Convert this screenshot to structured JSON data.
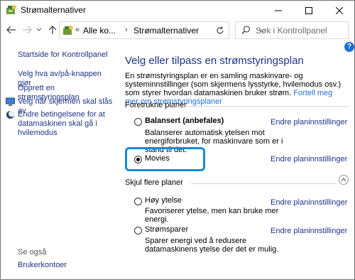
{
  "window": {
    "title": "Strømalternativer"
  },
  "address": {
    "overflow": "«",
    "crumbs": [
      "Alle ko...",
      "Strømalternativer"
    ],
    "separator": "›"
  },
  "search": {
    "placeholder": "Søk i Kontrollpanel"
  },
  "sidebar": {
    "home": "Startside for Kontrollpanel",
    "links": [
      "Velg hva av/på-knappen gjør",
      "Opprett en strømstyringsplan",
      "Velg når skjermen skal slås av",
      "Endre betingelsene for at datamaskinen skal gå i hvilemodus"
    ],
    "see_also_heading": "Se også",
    "see_also_links": [
      "Brukerkontoer"
    ]
  },
  "main": {
    "heading": "Velg eller tilpass en strømstyringsplan",
    "intro": "En strømstyringsplan er en samling maskinvare- og systeminnstillinger (som skjermens lysstyrke, hvilemodus osv.) som styrer hvordan datamaskinen bruker strøm.",
    "intro_link": "Fortell meg mer om strømstyringsplaner",
    "preferred_heading": "Foretrukne planer",
    "hide_heading": "Skjul flere planer",
    "change_link": "Endre planinnstillinger",
    "plans": [
      {
        "name": "Balansert (anbefales)",
        "desc": "Balanserer automatisk ytelsen mot energiforbruket, for maskinvare som er i stand til det.",
        "selected": false
      },
      {
        "name": "Movies",
        "desc": "",
        "selected": true
      },
      {
        "name": "Høy ytelse",
        "desc": "Favoriserer ytelse, men kan bruke mer energi.",
        "selected": false
      },
      {
        "name": "Strømsparer",
        "desc": "Sparer energi ved å redusere datamaskinens ytelse der det er mulig.",
        "selected": false
      }
    ]
  },
  "colors": {
    "link": "#1e3287",
    "accent": "#1a8ad4"
  },
  "help_label": "?"
}
